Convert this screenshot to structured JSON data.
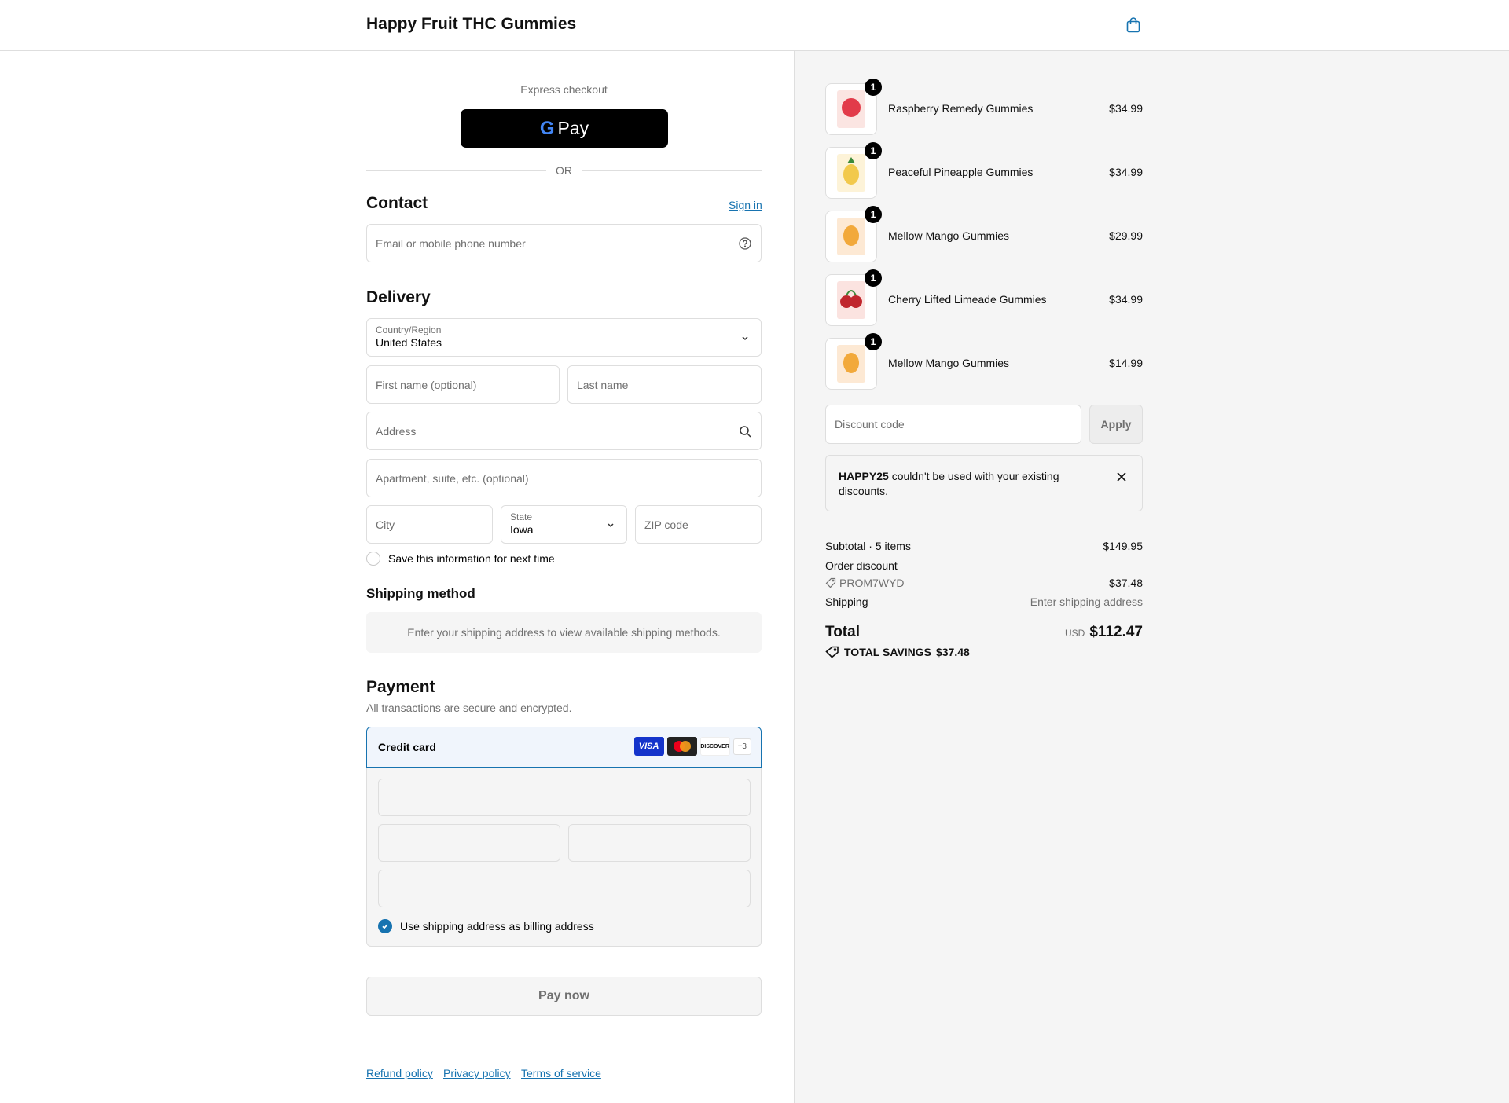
{
  "header": {
    "brand": "Happy Fruit THC Gummies"
  },
  "express": {
    "label": "Express checkout",
    "gpay_label": "Pay",
    "or": "OR"
  },
  "contact": {
    "title": "Contact",
    "sign_in": "Sign in",
    "email_placeholder": "Email or mobile phone number"
  },
  "delivery": {
    "title": "Delivery",
    "country_label": "Country/Region",
    "country_value": "United States",
    "first_name_placeholder": "First name (optional)",
    "last_name_placeholder": "Last name",
    "address_placeholder": "Address",
    "apartment_placeholder": "Apartment, suite, etc. (optional)",
    "city_placeholder": "City",
    "state_label": "State",
    "state_value": "Iowa",
    "zip_placeholder": "ZIP code",
    "save_info": "Save this information for next time"
  },
  "shipping": {
    "title": "Shipping method",
    "info": "Enter your shipping address to view available shipping methods."
  },
  "payment": {
    "title": "Payment",
    "subtitle": "All transactions are secure and encrypted.",
    "method": "Credit card",
    "cards": [
      "VISA",
      "Mastercard",
      "DISCOVER"
    ],
    "more_cards": "+3",
    "billing_same": "Use shipping address as billing address",
    "pay_now": "Pay now"
  },
  "footer": {
    "links": [
      "Refund policy",
      "Privacy policy",
      "Terms of service"
    ]
  },
  "summary": {
    "items": [
      {
        "name": "Raspberry Remedy Gummies",
        "price": "$34.99",
        "qty": "1",
        "color": "#e23b4a"
      },
      {
        "name": "Peaceful Pineapple Gummies",
        "price": "$34.99",
        "qty": "1",
        "color": "#f2c94c"
      },
      {
        "name": "Mellow Mango Gummies",
        "price": "$29.99",
        "qty": "1",
        "color": "#f2a93b"
      },
      {
        "name": "Cherry Lifted Limeade Gummies",
        "price": "$34.99",
        "qty": "1",
        "color": "#c0262d"
      },
      {
        "name": "Mellow Mango Gummies",
        "price": "$14.99",
        "qty": "1",
        "color": "#f2a93b"
      }
    ],
    "discount_placeholder": "Discount code",
    "apply": "Apply",
    "notice_code": "HAPPY25",
    "notice_text": " couldn't be used with your existing discounts.",
    "subtotal_label": "Subtotal · 5 items",
    "subtotal_value": "$149.95",
    "order_discount_label": "Order discount",
    "discount_code": "PROM7WYD",
    "discount_value": "– $37.48",
    "shipping_label": "Shipping",
    "shipping_value": "Enter shipping address",
    "total_label": "Total",
    "currency": "USD",
    "total_value": "$112.47",
    "savings_label": "TOTAL SAVINGS",
    "savings_value": "$37.48"
  },
  "colors": {
    "accent": "#1773b0",
    "gpay_bg": "#000000",
    "visa": "#1434cb"
  }
}
